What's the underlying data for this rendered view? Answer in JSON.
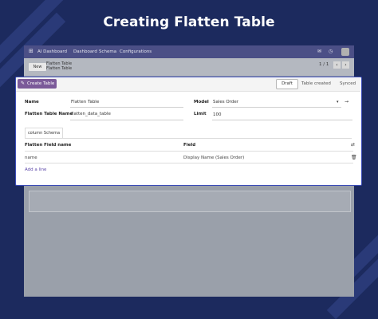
{
  "banner": {
    "title": "Creating Flatten Table"
  },
  "topnav": {
    "apps_glyph": "⊞",
    "brand": "AI Dashboard",
    "menu": [
      "Dashboard",
      "Schema",
      "Configurations"
    ],
    "icons": [
      "chat-icon",
      "activity-icon"
    ]
  },
  "control_panel": {
    "new_label": "New",
    "breadcrumb_parent": "Flatten Table",
    "breadcrumb_current": "Flatten Table",
    "pager": "1 / 1"
  },
  "form": {
    "create_button": "Create Table",
    "stages": [
      "Draft",
      "Table created",
      "Synced"
    ],
    "active_stage": "Draft",
    "fields": {
      "name_label": "Name",
      "name_value": "Flatten Table",
      "table_name_label": "Flatten Table Name",
      "table_name_value": "flatten_data_table",
      "model_label": "Model",
      "model_value": "Sales Order",
      "limit_label": "Limit",
      "limit_value": "100"
    },
    "tab_label": "column Schema",
    "table": {
      "columns": [
        "Flatten Field name",
        "Field"
      ],
      "rows": [
        {
          "name": "name",
          "field": "Display Name (Sales Order)"
        }
      ],
      "add_line": "Add a line"
    }
  },
  "colors": {
    "background": "#1c2a5e",
    "navbar": "#4b4f86",
    "primary": "#7b5a99",
    "card_border": "#3a4bb8",
    "link": "#5b46a8"
  }
}
